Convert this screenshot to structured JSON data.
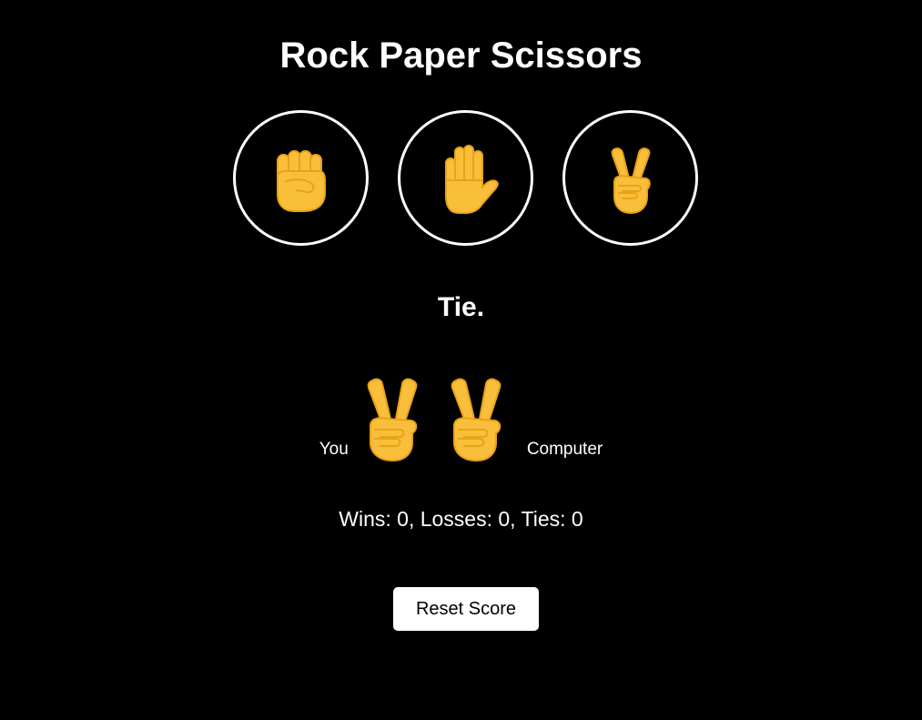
{
  "title": "Rock Paper Scissors",
  "choices": [
    {
      "name": "rock",
      "icon": "raised-fist-icon"
    },
    {
      "name": "paper",
      "icon": "raised-hand-icon"
    },
    {
      "name": "scissors",
      "icon": "victory-hand-icon"
    }
  ],
  "result": "Tie.",
  "moves": {
    "you_label": "You",
    "you_move": "scissors",
    "you_icon": "victory-hand-icon",
    "computer_label": "Computer",
    "computer_move": "scissors",
    "computer_icon": "victory-hand-icon"
  },
  "score": {
    "text": "Wins: 0, Losses: 0, Ties: 0",
    "wins": 0,
    "losses": 0,
    "ties": 0
  },
  "reset_button": "Reset Score",
  "colors": {
    "background": "#000000",
    "text": "#ffffff",
    "emoji": "#F9BF3B",
    "emoji_shade": "#E8A317"
  }
}
